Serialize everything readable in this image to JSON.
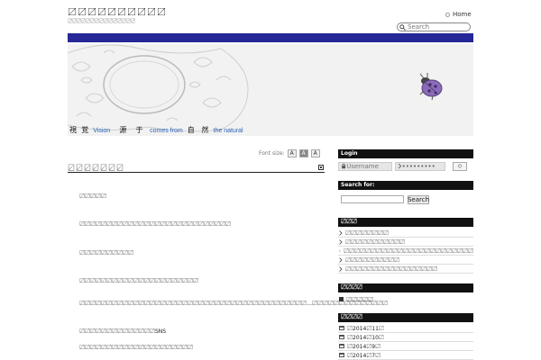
{
  "site": {
    "title": "〼〼〼〼〼〼〼〼〼〼",
    "description": "〼〼〼〼〼〼〼〼〼〼〼〼〼〼〼"
  },
  "top_nav": {
    "home_label": "Home"
  },
  "top_search": {
    "placeholder": "Search"
  },
  "header": {
    "tagline": {
      "w1": "視",
      "w2": "覚",
      "w3": "Vision",
      "w4": "源",
      "w5": "于",
      "w6": "comes from",
      "w7": "自",
      "w8": "然",
      "w9": "the natural"
    }
  },
  "font_size": {
    "label": "Font size:",
    "small": "A",
    "medium": "A",
    "large": "A"
  },
  "post": {
    "title": "〼〼〼〼〼〼〼",
    "lines": [
      "〼〼〼〼〼",
      "〼〼〼〼〼〼〼〼〼〼〼〼〼〼〼〼〼〼〼〼〼〼〼〼〼〼〼〼",
      "〼〼〼〼〼〼〼〼〼〼",
      "〼〼〼〼〼〼〼〼〼〼〼〼〼〼〼〼〼〼〼〼〼〼",
      "〼〼〼〼〼〼〼〼〼〼〼〼〼〼〼〼〼〼〼〼〼〼〼〼〼〼〼〼〼〼〼〼〼〼〼〼〼〼〼〼〼〼…〼〼〼〼〼〼〼〼〼〼〼〼〼〼",
      "〼〼〼〼〼〼〼〼〼〼〼〼〼〼SNS",
      "〼〼〼〼〼〼〼〼〼〼〼〼〼〼〼〼〼〼〼〼〼"
    ]
  },
  "sidebar": {
    "login": {
      "header": "Login",
      "username_placeholder": "Username",
      "password_value": "•••••••••",
      "go_label": "◇"
    },
    "search": {
      "header": "Search for:",
      "button": "Search"
    },
    "recent": {
      "header": "〼〼〼",
      "items": [
        "〼〼〼〼〼〼〼〼",
        "〼〼〼〼〼〼〼〼〼〼〼",
        "〼〼〼〼〼〼〼〼〼〼〼〼〼〼〼〼〼〼〼〼〼〼〼〼",
        "〼〼〼〼〼〼〼〼〼〼",
        "〼〼〼〼〼〼〼〼〼〼〼〼〼〼〼〼〼"
      ]
    },
    "categories": {
      "header": "〼〼〼〼",
      "items": [
        "〼〼〼〼〼"
      ]
    },
    "archives": {
      "header": "〼〼〼〼",
      "items": [
        "〼2014〼11〼",
        "〼2014〼10〼",
        "〼2014〼9〼",
        "〼2014〼7〼"
      ]
    }
  },
  "colors": {
    "nav_bar": "#252896",
    "tagline_accent": "#2a63b6",
    "sidebar_header": "#111111",
    "bug": "#7b5aa6"
  }
}
